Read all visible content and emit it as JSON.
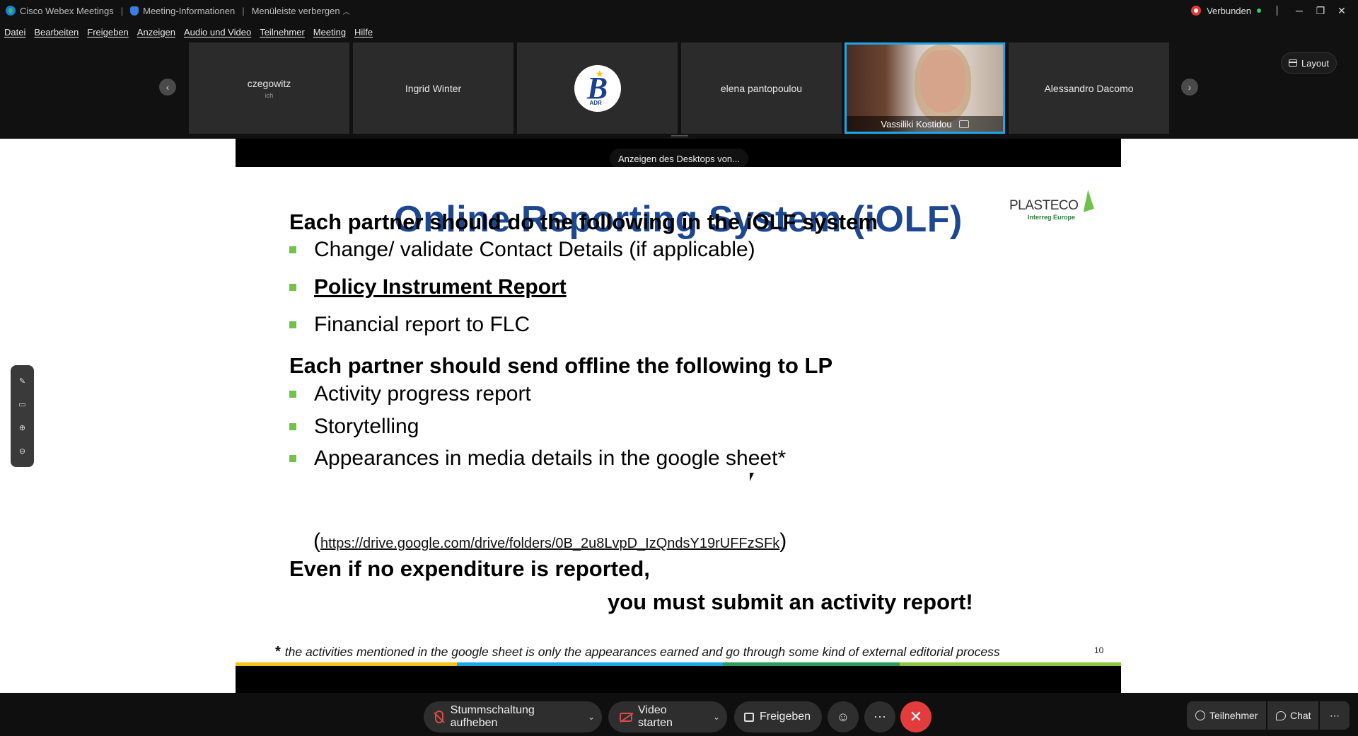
{
  "titlebar": {
    "app_name": "Cisco Webex Meetings",
    "meeting_info": "Meeting-Informationen",
    "hide_menu": "Menüleiste verbergen",
    "status": "Verbunden"
  },
  "menu": [
    "Datei",
    "Bearbeiten",
    "Freigeben",
    "Anzeigen",
    "Audio und Video",
    "Teilnehmer",
    "Meeting",
    "Hilfe"
  ],
  "participants": [
    {
      "name": "czegowitz",
      "sub": "ich"
    },
    {
      "name": "Ingrid Winter"
    },
    {
      "name": "",
      "logo_text": "ADR"
    },
    {
      "name": "elena pantopoulou"
    },
    {
      "name": "Vassiliki Kostidou"
    },
    {
      "name": "Alessandro Dacomo"
    }
  ],
  "layout_label": "Layout",
  "sharing_label": "Anzeigen des Desktops von...",
  "slide": {
    "title": "Online Reporting System (iOLF)",
    "logo_name": "PLASTECO",
    "logo_sub": "Interreg Europe",
    "heading1": "Each partner should do the following in the iOLF system",
    "items1": [
      "Change/ validate Contact Details (if applicable)",
      "Policy Instrument Report",
      "Financial report to FLC"
    ],
    "heading2": "Each partner should send offline the following to LP",
    "items2": [
      "Activity progress report",
      "Storytelling",
      "Appearances in media details in the google sheet*"
    ],
    "link_open": "(",
    "link": "https://drive.google.com/drive/folders/0B_2u8LvpD_IzQndsY19rUFFzSFk",
    "link_close": ")",
    "warning1": "Even if no expenditure is reported,",
    "warning2": "you must submit an activity report!",
    "footnote_star": "*",
    "footnote": "the activities mentioned in the google sheet is only the appearances earned and go through some kind of external editorial process",
    "page_number": "10",
    "band_colors": [
      "#f2c31b",
      "#1ea7e8",
      "#2d9b5a",
      "#8cc63f"
    ],
    "title_color": "#1d4790",
    "bullet_color": "#72c34a"
  },
  "controls": {
    "unmute": "Stummschaltung aufheben",
    "video": "Video starten",
    "share": "Freigeben",
    "participants": "Teilnehmer",
    "chat": "Chat"
  }
}
